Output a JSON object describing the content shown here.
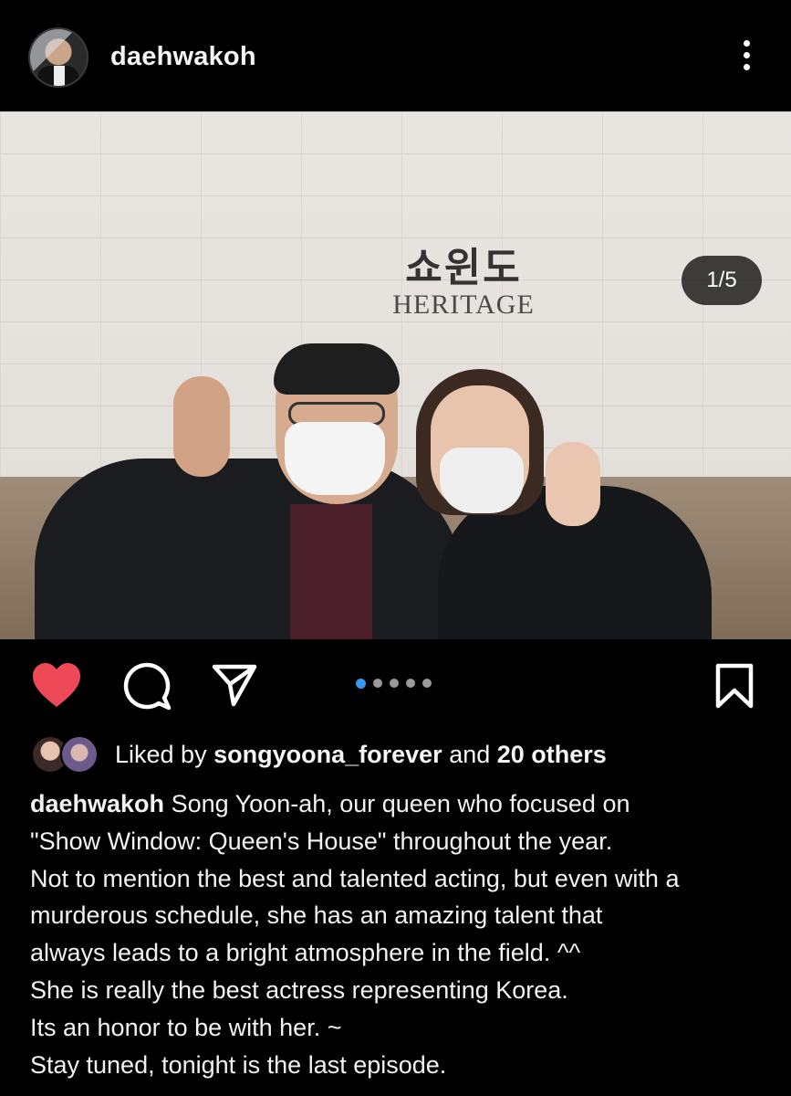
{
  "header": {
    "username": "daehwakoh",
    "avatar_icon": "profile-avatar",
    "more_icon": "more-vertical-icon"
  },
  "post": {
    "image_sign_korean": "쇼윈도",
    "image_sign_english": "HERITAGE",
    "carousel_counter": "1/5",
    "carousel_total": 5,
    "carousel_current": 1
  },
  "actions": {
    "like_icon": "heart-filled-icon",
    "comment_icon": "comment-icon",
    "share_icon": "paper-plane-icon",
    "save_icon": "bookmark-icon",
    "like_color": "#ed4956",
    "active_dot_color": "#3897f0"
  },
  "likes": {
    "prefix": "Liked by",
    "user": "songyoona_forever",
    "middle": "and",
    "others": "20 others"
  },
  "caption": {
    "author": "daehwakoh",
    "line1": "Song Yoon-ah, our queen who focused on",
    "line2": "\"Show Window: Queen's House\" throughout the year.",
    "line3": "Not to mention the best and talented acting, but even with a",
    "line4": "murderous schedule, she has an amazing talent that",
    "line5": "always leads to a  bright atmosphere in the field. ^^",
    "line6": "She is really the best actress representing Korea.",
    "line7": "Its an honor to be with her. ~",
    "line8": "Stay tuned, tonight  is the last episode."
  }
}
